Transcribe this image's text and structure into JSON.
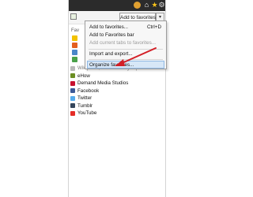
{
  "toolbar": {
    "add_to_favorites_label": "Add to favorites",
    "dropdown_glyph": "▾"
  },
  "panel": {
    "label": "Fav"
  },
  "menu": {
    "items": [
      {
        "label": "Add to favorites...",
        "shortcut": "Ctrl+D",
        "enabled": true
      },
      {
        "label": "Add to Favorites bar",
        "enabled": true
      },
      {
        "label": "Add current tabs to favorites...",
        "enabled": false
      },
      {
        "label": "Import and export...",
        "enabled": true
      },
      {
        "label": "Organize favorites...",
        "enabled": true,
        "highlighted": true
      }
    ]
  },
  "favorites": [
    {
      "label": "Wikipedia, the free encyclopedia",
      "icon": "wikipedia-icon",
      "color": "#b9b9b9",
      "muted": true
    },
    {
      "label": "eHow",
      "icon": "ehow-icon",
      "color": "#6b8e23"
    },
    {
      "label": "Demand Media Studios",
      "icon": "dms-icon",
      "color": "#c8102e"
    },
    {
      "label": "Facebook",
      "icon": "facebook-icon",
      "color": "#3b5998"
    },
    {
      "label": "Twitter",
      "icon": "twitter-icon",
      "color": "#55acee"
    },
    {
      "label": "Tumblr",
      "icon": "tumblr-icon",
      "color": "#35465c"
    },
    {
      "label": "YouTube",
      "icon": "youtube-icon",
      "color": "#e52d27"
    }
  ],
  "colors": {
    "menu_highlight": "#d7e7f7",
    "arrow": "#d31f26",
    "topbar": "#2b2b2b"
  }
}
